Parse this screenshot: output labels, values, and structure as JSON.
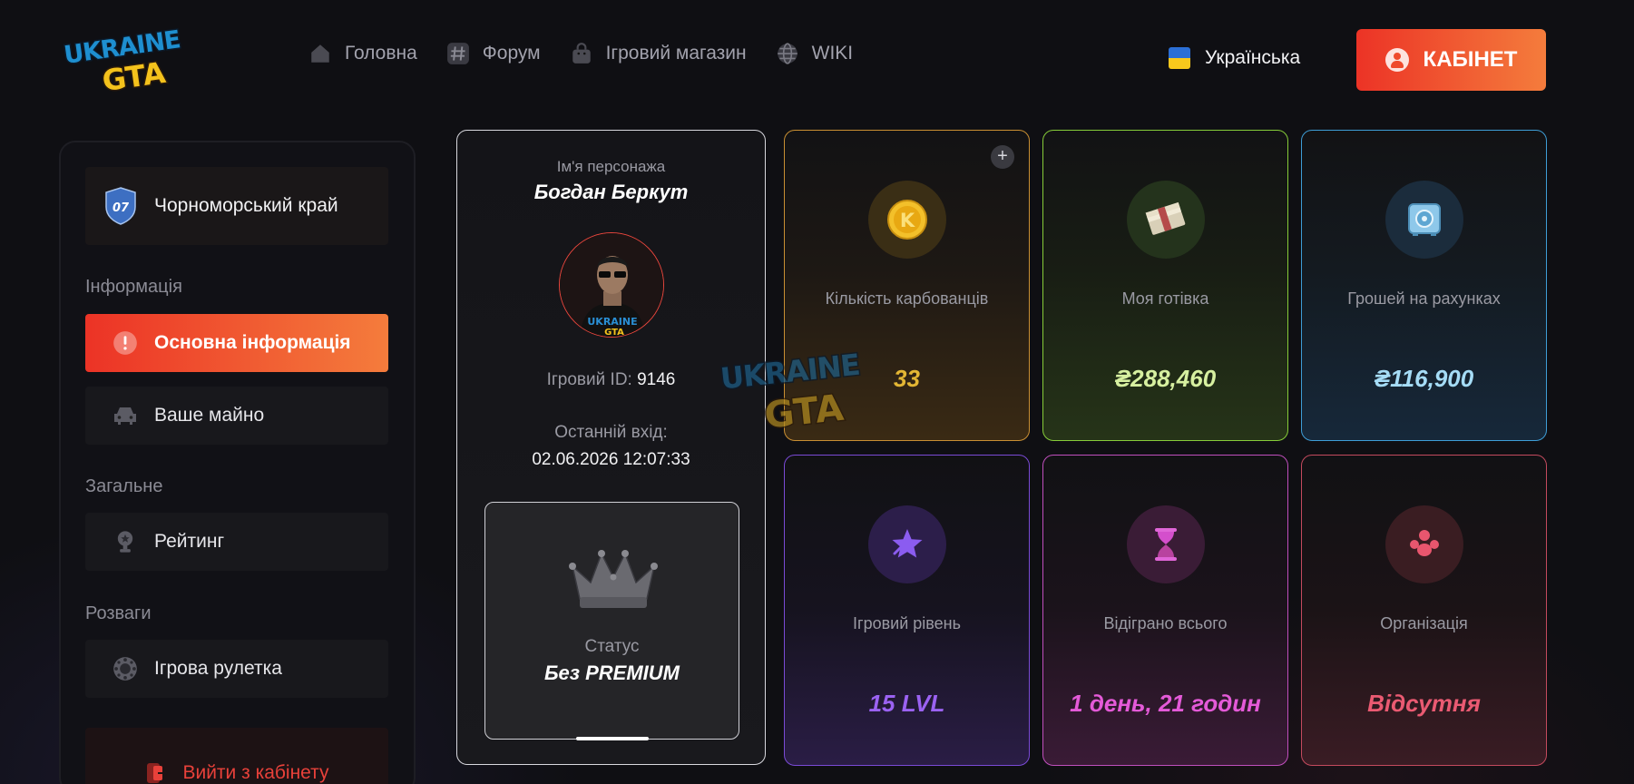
{
  "header": {
    "logo_text_top": "UKRAINE",
    "logo_text_bottom": "GTA",
    "nav": [
      {
        "label": "Головна",
        "icon": "home-icon"
      },
      {
        "label": "Форум",
        "icon": "hashtag-icon"
      },
      {
        "label": "Ігровий магазин",
        "icon": "shopping-bag-icon"
      },
      {
        "label": "WIKI",
        "icon": "globe-icon"
      }
    ],
    "language": "Українська",
    "cabinet_label": "КАБІНЕТ"
  },
  "sidebar": {
    "server_name": "Чорноморський край",
    "server_badge": "07",
    "sections": [
      {
        "title": "Інформація",
        "items": [
          {
            "label": "Основна інформація",
            "icon": "alert-circle-icon",
            "active": true
          },
          {
            "label": "Ваше майно",
            "icon": "car-icon",
            "active": false
          }
        ]
      },
      {
        "title": "Загальне",
        "items": [
          {
            "label": "Рейтинг",
            "icon": "trophy-icon",
            "active": false
          }
        ]
      },
      {
        "title": "Розваги",
        "items": [
          {
            "label": "Ігрова рулетка",
            "icon": "roulette-icon",
            "active": false
          }
        ]
      }
    ],
    "logout_label": "Вийти з кабінету"
  },
  "profile": {
    "name_label": "Ім'я персонажа",
    "name": "Богдан Беркут",
    "id_label": "Ігровий ID:",
    "id_value": "9146",
    "last_login_label": "Останній вхід:",
    "last_login_value": "02.06.2026 12:07:33",
    "status_label": "Статус",
    "status_value": "Без PREMIUM"
  },
  "stats": [
    {
      "label": "Кількість карбованців",
      "value": "33",
      "color": "#e3b634",
      "icon": "coin-icon",
      "has_add": true
    },
    {
      "label": "Моя готівка",
      "value": "₴288,460",
      "color": "#d7f0a0",
      "icon": "cash-stack-icon",
      "has_add": false
    },
    {
      "label": "Грошей на рахунках",
      "value": "₴116,900",
      "color": "#a5dcf6",
      "icon": "safe-icon",
      "has_add": false
    },
    {
      "label": "Ігровий рівень",
      "value": "15 LVL",
      "color": "#9b62f2",
      "icon": "star-icon",
      "has_add": false
    },
    {
      "label": "Відіграно всього",
      "value": "1 день, 21 годин",
      "color": "#e45ad8",
      "icon": "hourglass-icon",
      "has_add": false
    },
    {
      "label": "Організація",
      "value": "Відсутня",
      "color": "#ea5a72",
      "icon": "group-icon",
      "has_add": false
    }
  ],
  "colors": {
    "accent_start": "#ec3326",
    "accent_end": "#f47c3c",
    "background": "#0f0f13"
  }
}
